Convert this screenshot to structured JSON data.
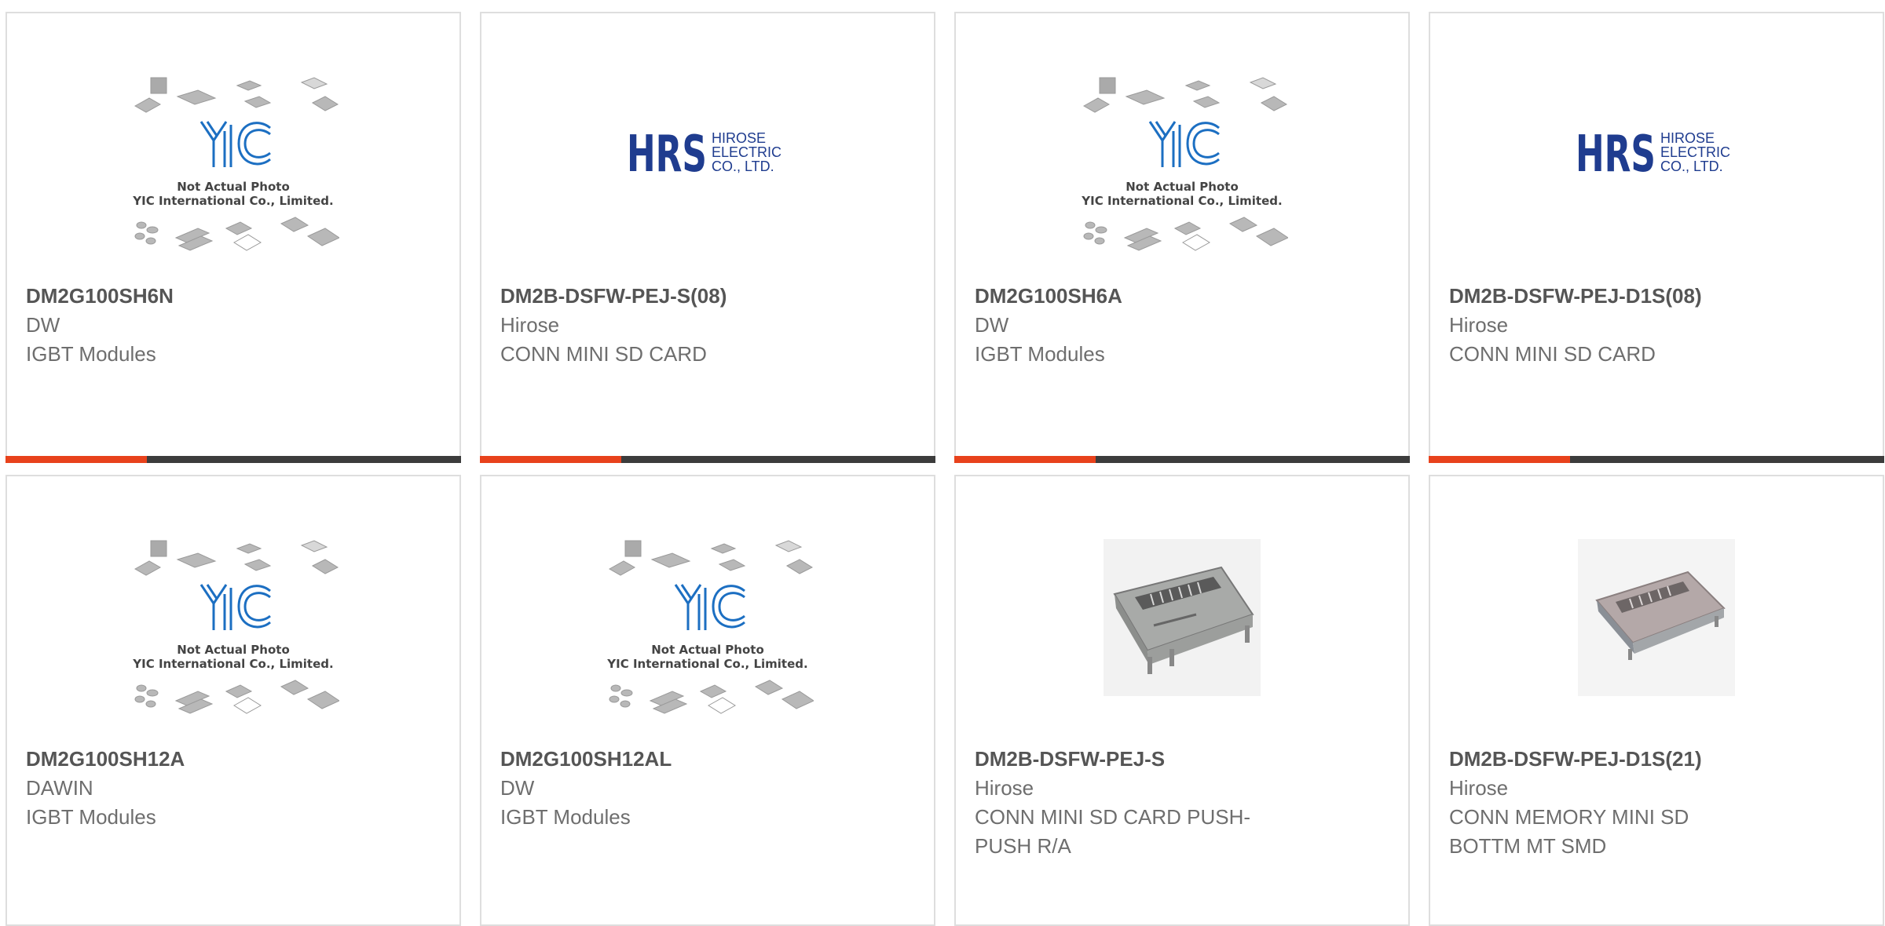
{
  "colors": {
    "accent": "#e8421c",
    "track": "#3c3c3c",
    "hirose_blue": "#1f3c8f",
    "yic_blue": "#1c6fc2"
  },
  "products": [
    {
      "part_number": "DM2G100SH6N",
      "manufacturer": "DW",
      "description": "IGBT Modules",
      "image": "yic-placeholder",
      "image_text": {
        "line1": "Not Actual Photo",
        "line2": "YIC International Co., Limited."
      },
      "progress": 0.31
    },
    {
      "part_number": "DM2B-DSFW-PEJ-S(08)",
      "manufacturer": "Hirose",
      "description": "CONN MINI SD CARD",
      "image": "hirose-logo",
      "logo_text": {
        "mark": "HRS",
        "l1": "HIROSE",
        "l2": "ELECTRIC",
        "l3": "CO., LTD."
      },
      "progress": 0.31
    },
    {
      "part_number": "DM2G100SH6A",
      "manufacturer": "DW",
      "description": "IGBT Modules",
      "image": "yic-placeholder",
      "image_text": {
        "line1": "Not Actual Photo",
        "line2": "YIC International Co., Limited."
      },
      "progress": 0.31
    },
    {
      "part_number": "DM2B-DSFW-PEJ-D1S(08)",
      "manufacturer": "Hirose",
      "description": "CONN MINI SD CARD",
      "image": "hirose-logo",
      "logo_text": {
        "mark": "HRS",
        "l1": "HIROSE",
        "l2": "ELECTRIC",
        "l3": "CO., LTD."
      },
      "progress": 0.31
    },
    {
      "part_number": "DM2G100SH12A",
      "manufacturer": "DAWIN",
      "description": "IGBT Modules",
      "image": "yic-placeholder",
      "image_text": {
        "line1": "Not Actual Photo",
        "line2": "YIC International Co., Limited."
      },
      "progress": 0
    },
    {
      "part_number": "DM2G100SH12AL",
      "manufacturer": "DW",
      "description": "IGBT Modules",
      "image": "yic-placeholder",
      "image_text": {
        "line1": "Not Actual Photo",
        "line2": "YIC International Co., Limited."
      },
      "progress": 0
    },
    {
      "part_number": "DM2B-DSFW-PEJ-S",
      "manufacturer": "Hirose",
      "description": "CONN MINI SD CARD PUSH-PUSH R/A",
      "image": "sd-connector-photo",
      "progress": 0
    },
    {
      "part_number": "DM2B-DSFW-PEJ-D1S(21)",
      "manufacturer": "Hirose",
      "description": "CONN MEMORY MINI SD BOTTM MT SMD",
      "image": "sd-connector-photo-small",
      "progress": 0
    }
  ]
}
